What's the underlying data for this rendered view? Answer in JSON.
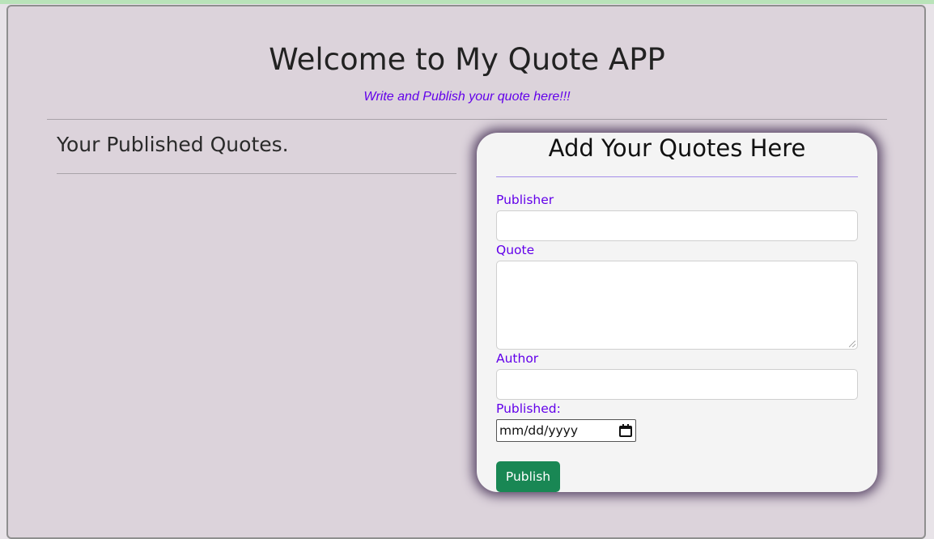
{
  "header": {
    "title": "Welcome to My Quote APP",
    "subtitle": "Write and Publish your quote here!!!"
  },
  "published": {
    "heading": "Your Published Quotes."
  },
  "form": {
    "title": "Add Your Quotes Here",
    "publisher_label": "Publisher",
    "publisher_value": "",
    "quote_label": "Quote",
    "quote_value": "",
    "author_label": "Author",
    "author_value": "",
    "published_label": "Published:",
    "date_placeholder": "mm/dd/yyyy",
    "submit_label": "Publish"
  },
  "colors": {
    "accent": "#6200ea",
    "button": "#198754",
    "background": "#dcd3db",
    "card": "#f4f4f4"
  },
  "icons": {
    "date": "calendar-icon"
  }
}
